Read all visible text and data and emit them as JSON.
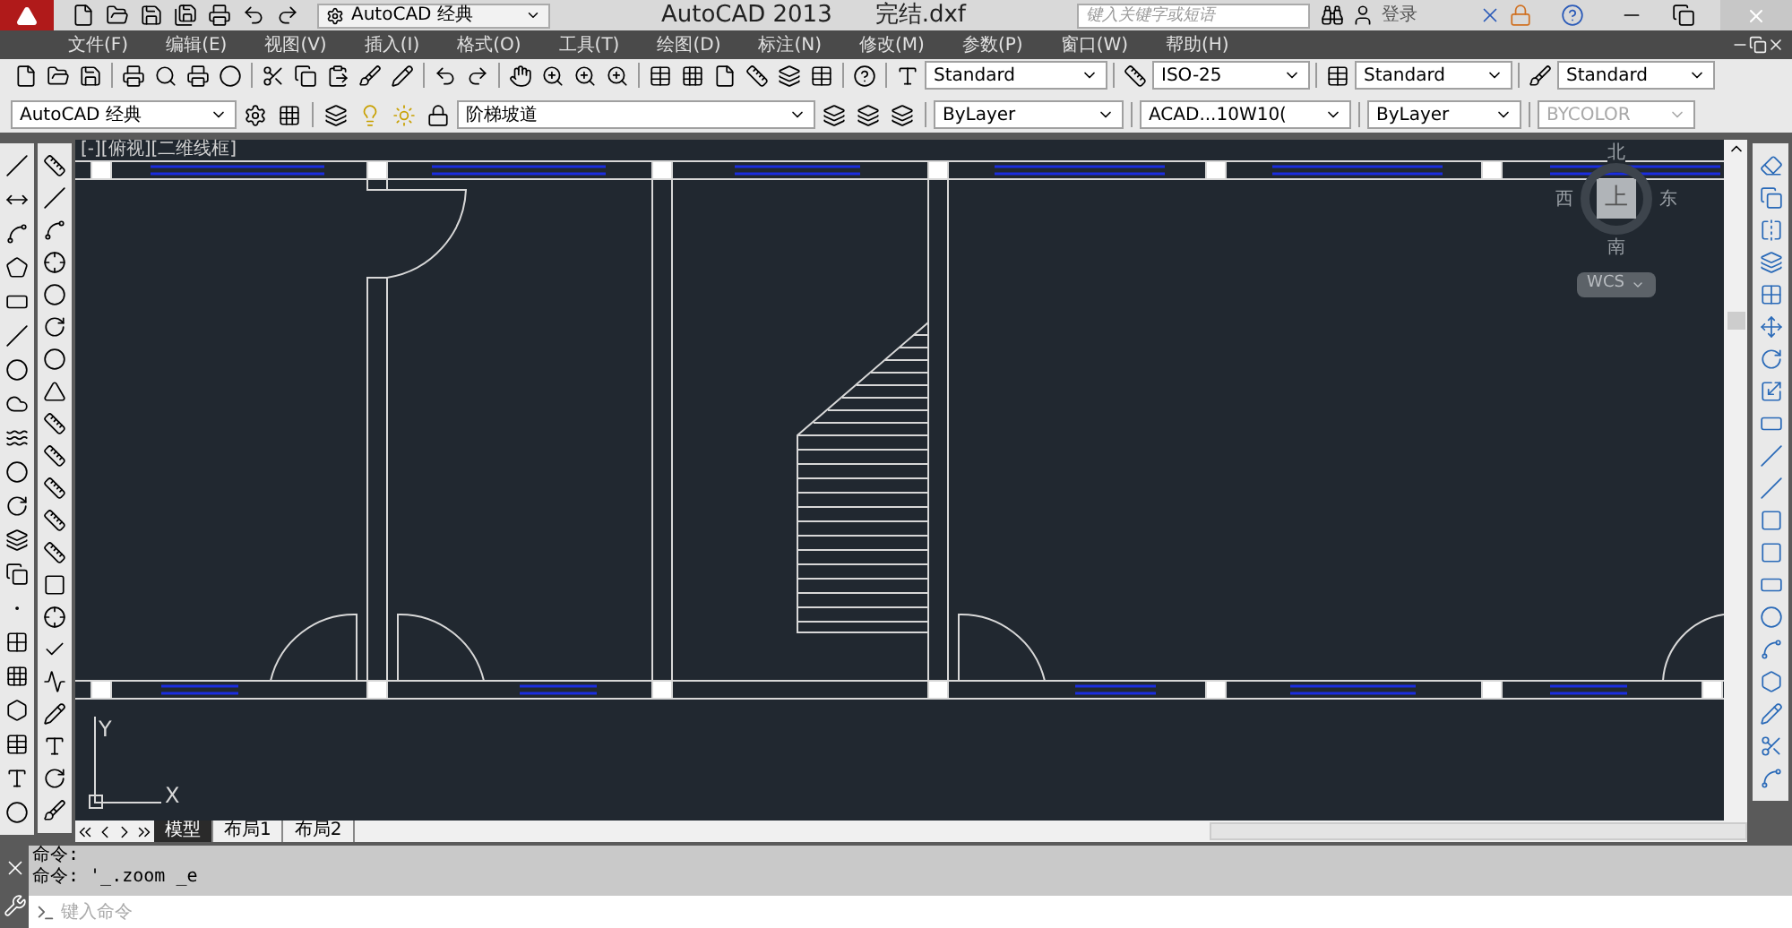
{
  "title_bar": {
    "workspace": "AutoCAD 经典",
    "app_title": "AutoCAD 2013",
    "file_name": "完结.dxf",
    "search": {
      "placeholder": "键入关键字或短语"
    },
    "sign_in": "登录"
  },
  "menu": [
    "文件(F)",
    "编辑(E)",
    "视图(V)",
    "插入(I)",
    "格式(O)",
    "工具(T)",
    "绘图(D)",
    "标注(N)",
    "修改(M)",
    "参数(P)",
    "窗口(W)",
    "帮助(H)"
  ],
  "style_toolbar": {
    "text_style": "Standard",
    "dim_style": "ISO-25",
    "table_style": "Standard",
    "multileader_style": "Standard"
  },
  "properties_toolbar": {
    "workspace": "AutoCAD 经典",
    "layer": "阶梯坡道",
    "color_setting": "ByLayer",
    "linetype": "ACAD...10W10(",
    "lineweight": "ByLayer",
    "plot_style": {
      "value": "BYCOLOR",
      "disabled": true
    }
  },
  "viewport": {
    "label": "[-][俯视][二维线框]",
    "viewcube": {
      "north": "北",
      "west": "西",
      "top": "上",
      "east": "东",
      "south": "南",
      "ucs": "WCS"
    },
    "ucs_icon": {
      "y": "Y",
      "x": "X"
    }
  },
  "layout_tabs": [
    {
      "label": "模型",
      "selected": true
    },
    {
      "label": "布局1",
      "selected": false
    },
    {
      "label": "布局2",
      "selected": false
    }
  ],
  "command_line": {
    "history": [
      "命令:",
      "命令: '_.zoom _e"
    ],
    "placeholder": "键入命令"
  }
}
